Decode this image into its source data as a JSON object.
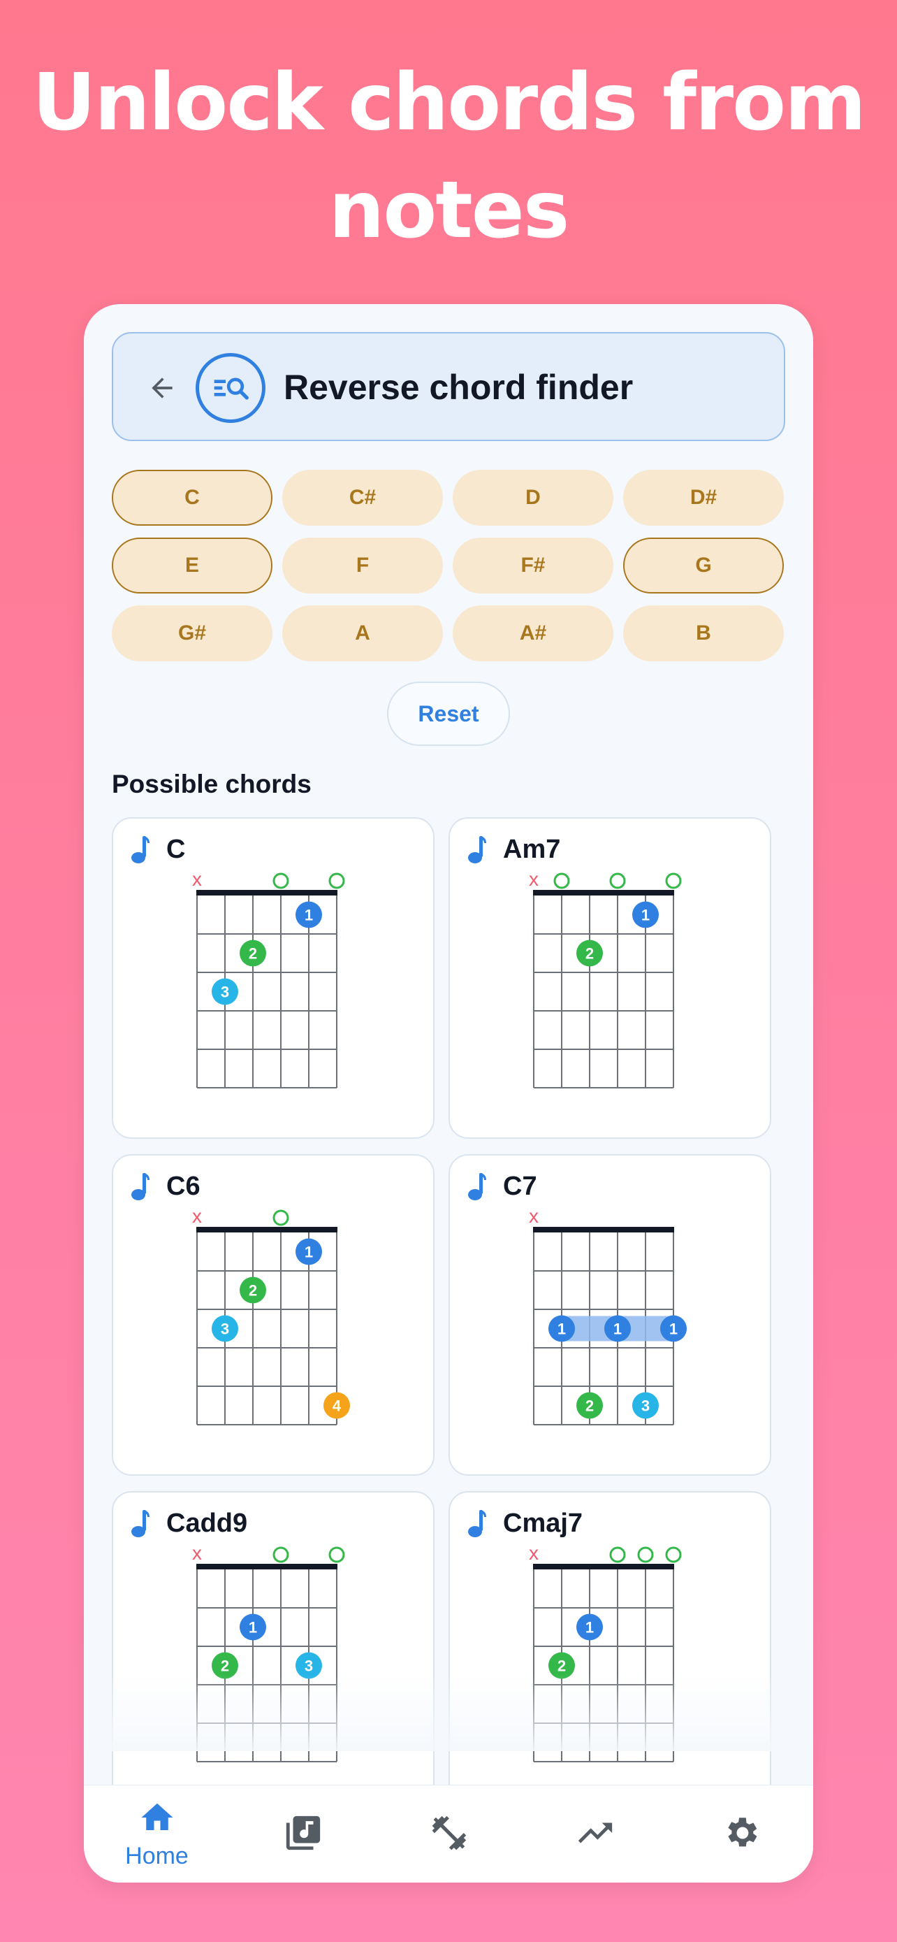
{
  "headline": [
    "Unlock chords from",
    "notes"
  ],
  "header": {
    "title": "Reverse chord finder"
  },
  "notes": [
    {
      "label": "C",
      "selected": true
    },
    {
      "label": "C#",
      "selected": false
    },
    {
      "label": "D",
      "selected": false
    },
    {
      "label": "D#",
      "selected": false
    },
    {
      "label": "E",
      "selected": true
    },
    {
      "label": "F",
      "selected": false
    },
    {
      "label": "F#",
      "selected": false
    },
    {
      "label": "G",
      "selected": true
    },
    {
      "label": "G#",
      "selected": false
    },
    {
      "label": "A",
      "selected": false
    },
    {
      "label": "A#",
      "selected": false
    },
    {
      "label": "B",
      "selected": false
    }
  ],
  "reset_label": "Reset",
  "section_title": "Possible chords",
  "colors": {
    "finger_1": "#2f80e0",
    "finger_2": "#34b84a",
    "finger_3": "#26b5e6",
    "finger_4": "#f5a31a",
    "muted": "#ef5a6f",
    "open": "#34b84a",
    "accent": "#2f80e0"
  },
  "chords": [
    {
      "name": "C",
      "strings": [
        "x",
        3,
        2,
        0,
        1,
        0
      ],
      "fingers": [
        null,
        3,
        2,
        null,
        1,
        null
      ],
      "barre": null
    },
    {
      "name": "Am7",
      "strings": [
        "x",
        0,
        2,
        0,
        1,
        0
      ],
      "fingers": [
        null,
        null,
        2,
        null,
        1,
        null
      ],
      "barre": null
    },
    {
      "name": "C6",
      "strings": [
        "x",
        3,
        2,
        0,
        1,
        5
      ],
      "fingers": [
        null,
        3,
        2,
        null,
        1,
        4
      ],
      "barre": null
    },
    {
      "name": "C7",
      "strings": [
        "x",
        3,
        5,
        3,
        5,
        3
      ],
      "fingers": [
        null,
        1,
        2,
        1,
        3,
        1
      ],
      "barre": {
        "fret": 3,
        "from": 1,
        "to": 5
      }
    },
    {
      "name": "Cadd9",
      "strings": [
        "x",
        3,
        2,
        0,
        3,
        0
      ],
      "fingers": [
        null,
        2,
        1,
        null,
        3,
        null
      ],
      "barre": null
    },
    {
      "name": "Cmaj7",
      "strings": [
        "x",
        3,
        2,
        0,
        0,
        0
      ],
      "fingers": [
        null,
        2,
        1,
        null,
        null,
        null
      ],
      "barre": null
    }
  ],
  "nav": {
    "items": [
      {
        "name": "home",
        "label": "Home",
        "icon": "home-icon",
        "active": true
      },
      {
        "name": "library",
        "label": "",
        "icon": "music-library-icon",
        "active": false
      },
      {
        "name": "practice",
        "label": "",
        "icon": "dumbbell-icon",
        "active": false
      },
      {
        "name": "progress",
        "label": "",
        "icon": "trending-up-icon",
        "active": false
      },
      {
        "name": "settings",
        "label": "",
        "icon": "gear-icon",
        "active": false
      }
    ]
  }
}
